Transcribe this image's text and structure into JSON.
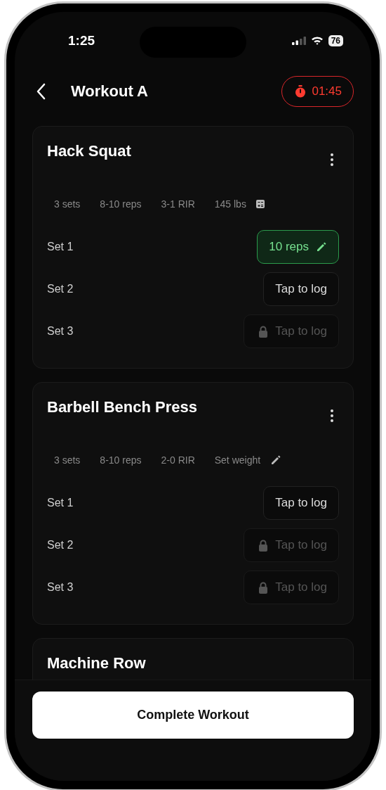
{
  "status_bar": {
    "time": "1:25",
    "battery": "76"
  },
  "header": {
    "title": "Workout A",
    "timer": "01:45"
  },
  "exercises": [
    {
      "name": "Hack Squat",
      "details": [
        "3 sets",
        "8-10 reps",
        "3-1 RIR"
      ],
      "weight": {
        "kind": "calculator",
        "text": "145 lbs"
      },
      "sets": [
        {
          "label": "Set 1",
          "kind": "logged",
          "text": "10 reps"
        },
        {
          "label": "Set 2",
          "kind": "open",
          "text": "Tap to log"
        },
        {
          "label": "Set 3",
          "kind": "locked",
          "text": "Tap to log"
        }
      ]
    },
    {
      "name": "Barbell Bench Press",
      "details": [
        "3 sets",
        "8-10 reps",
        "2-0 RIR"
      ],
      "weight": {
        "kind": "edit",
        "text": "Set weight"
      },
      "sets": [
        {
          "label": "Set 1",
          "kind": "open",
          "text": "Tap to log"
        },
        {
          "label": "Set 2",
          "kind": "locked",
          "text": "Tap to log"
        },
        {
          "label": "Set 3",
          "kind": "locked",
          "text": "Tap to log"
        }
      ]
    },
    {
      "name": "Machine Row"
    }
  ],
  "footer_button": "Complete Workout"
}
